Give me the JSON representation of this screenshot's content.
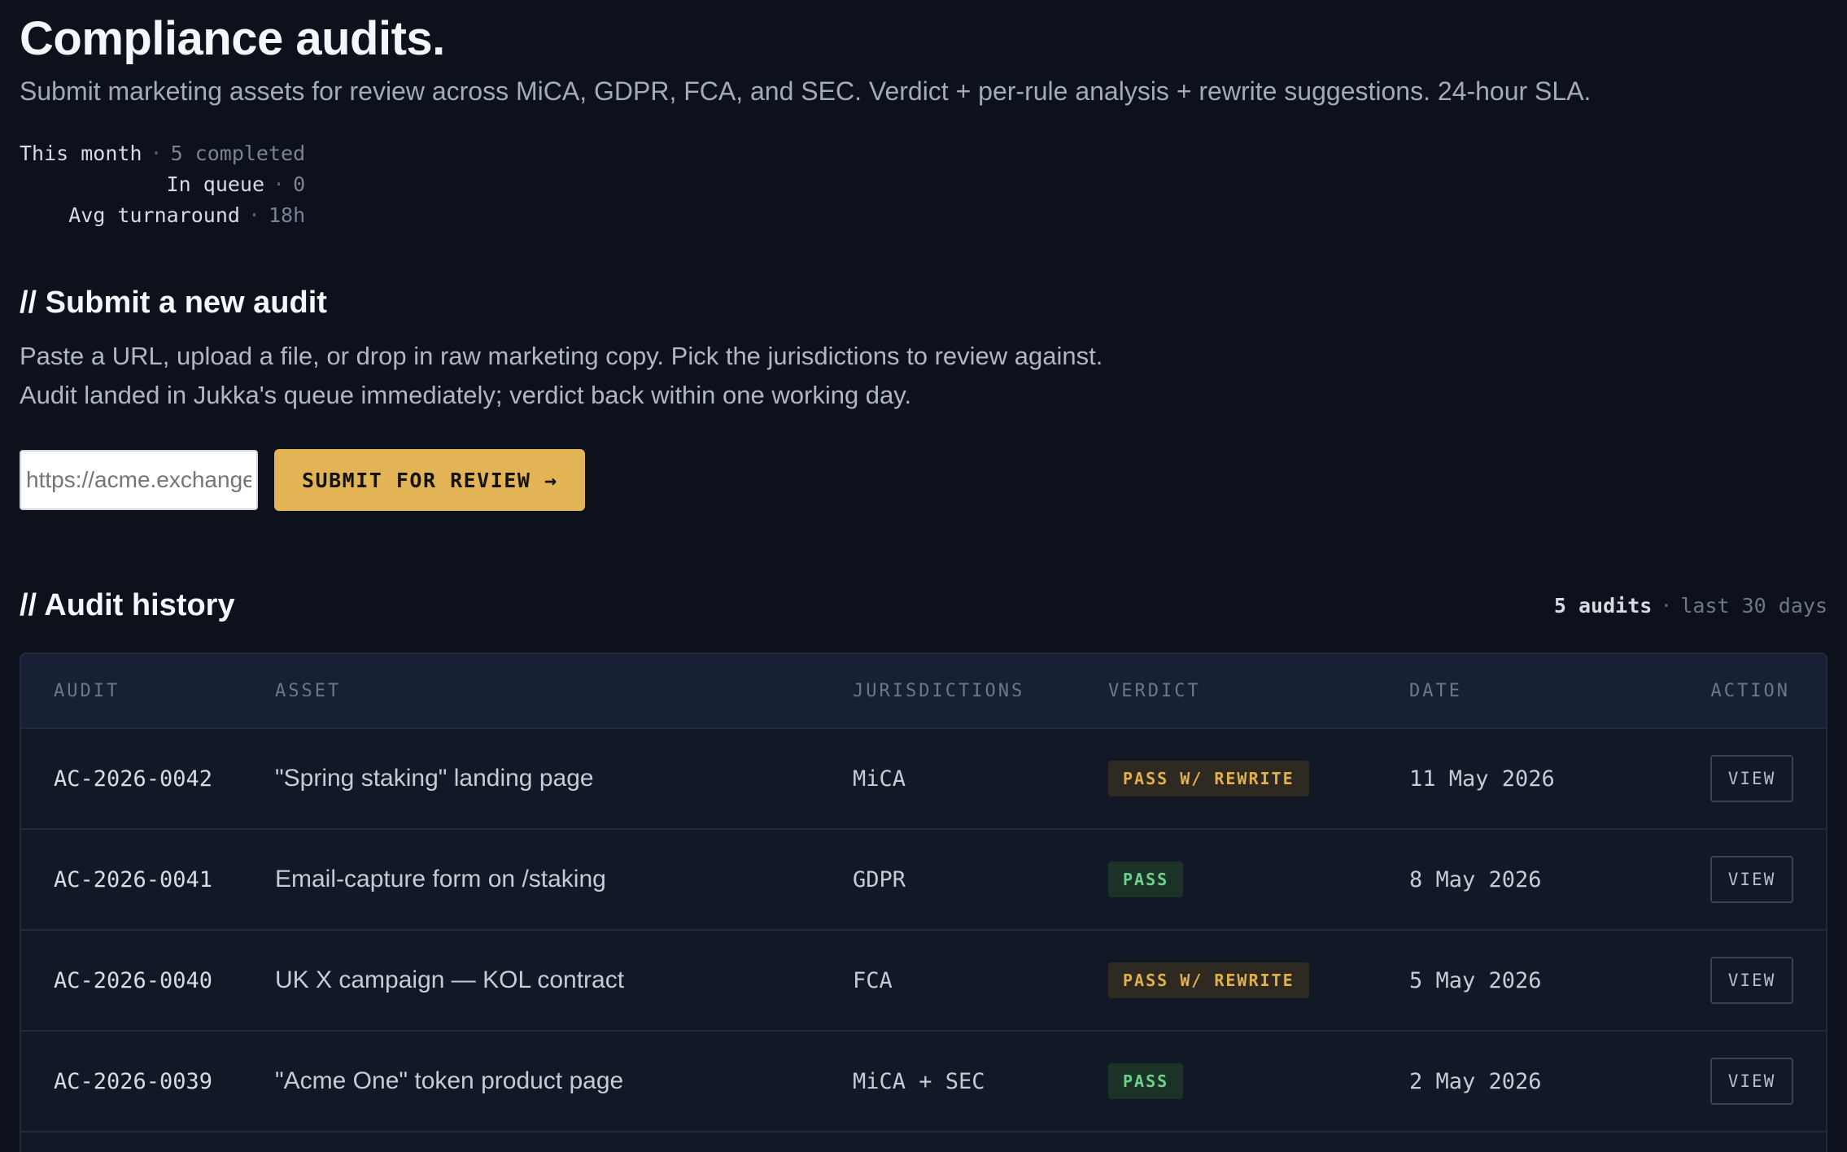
{
  "header": {
    "title": "Compliance audits.",
    "subtitle": "Submit marketing assets for review across MiCA, GDPR, FCA, and SEC. Verdict + per-rule analysis + rewrite suggestions. 24-hour SLA."
  },
  "stats": [
    {
      "label": "This month",
      "value": "5 completed"
    },
    {
      "label": "In queue",
      "value": "0"
    },
    {
      "label": "Avg turnaround",
      "value": "18h"
    }
  ],
  "submit": {
    "heading": "// Submit a new audit",
    "desc_line1": "Paste a URL, upload a file, or drop in raw marketing copy. Pick the jurisdictions to review against.",
    "desc_line2": "Audit landed in Jukka's queue immediately; verdict back within one working day.",
    "input_placeholder": "https://acme.exchange/campaign",
    "button_label": "SUBMIT FOR REVIEW →"
  },
  "history": {
    "heading": "// Audit history",
    "count": "5 audits",
    "range": "last 30 days",
    "columns": [
      "AUDIT",
      "ASSET",
      "JURISDICTIONS",
      "VERDICT",
      "DATE",
      "ACTION"
    ],
    "rows": [
      {
        "id": "AC-2026-0042",
        "asset": "\"Spring staking\" landing page",
        "jurisdictions": "MiCA",
        "verdict": "PASS W/ REWRITE",
        "verdict_type": "rewrite",
        "date": "11 May 2026",
        "action": "VIEW"
      },
      {
        "id": "AC-2026-0041",
        "asset": "Email-capture form on /staking",
        "jurisdictions": "GDPR",
        "verdict": "PASS",
        "verdict_type": "pass",
        "date": "8 May 2026",
        "action": "VIEW"
      },
      {
        "id": "AC-2026-0040",
        "asset": "UK X campaign — KOL contract",
        "jurisdictions": "FCA",
        "verdict": "PASS W/ REWRITE",
        "verdict_type": "rewrite",
        "date": "5 May 2026",
        "action": "VIEW"
      },
      {
        "id": "AC-2026-0039",
        "asset": "\"Acme One\" token product page",
        "jurisdictions": "MiCA + SEC",
        "verdict": "PASS",
        "verdict_type": "pass",
        "date": "2 May 2026",
        "action": "VIEW"
      }
    ]
  },
  "colors": {
    "background": "#0d111c",
    "accent": "#e3b455",
    "pass": "#6fd08c",
    "rewrite": "#e0b04f"
  }
}
